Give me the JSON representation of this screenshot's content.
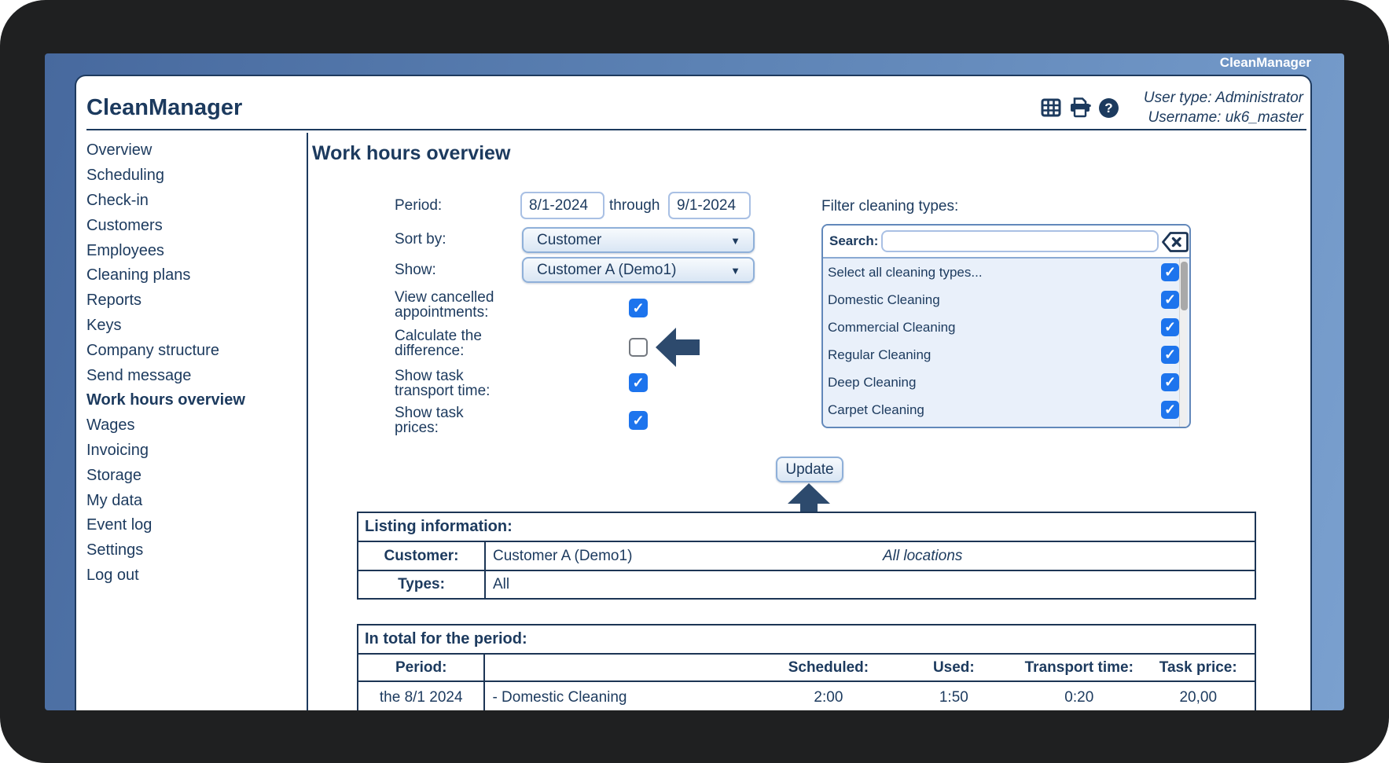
{
  "window": {
    "title": "CleanManager"
  },
  "header": {
    "app_title": "CleanManager",
    "user_type": "User type: Administrator",
    "username": "Username: uk6_master",
    "icons": [
      "table-grid",
      "printer",
      "help"
    ],
    "help_glyph": "?"
  },
  "sidebar": {
    "items": [
      {
        "label": "Overview",
        "active": false
      },
      {
        "label": "Scheduling",
        "active": false
      },
      {
        "label": "Check-in",
        "active": false
      },
      {
        "label": "Customers",
        "active": false
      },
      {
        "label": "Employees",
        "active": false
      },
      {
        "label": "Cleaning plans",
        "active": false
      },
      {
        "label": "Reports",
        "active": false
      },
      {
        "label": "Keys",
        "active": false
      },
      {
        "label": "Company structure",
        "active": false
      },
      {
        "label": "Send message",
        "active": false
      },
      {
        "label": "Work hours overview",
        "active": true
      },
      {
        "label": "Wages",
        "active": false
      },
      {
        "label": "Invoicing",
        "active": false
      },
      {
        "label": "Storage",
        "active": false
      },
      {
        "label": "My data",
        "active": false
      },
      {
        "label": "Event log",
        "active": false
      },
      {
        "label": "Settings",
        "active": false
      },
      {
        "label": "Log out",
        "active": false
      }
    ]
  },
  "main": {
    "heading": "Work hours overview",
    "form": {
      "period_label": "Period:",
      "period_from": "8/1-2024",
      "through_label": "through",
      "period_to": "9/1-2024",
      "sort_label": "Sort by:",
      "sort_value": "Customer",
      "show_label": "Show:",
      "show_value": "Customer A (Demo1)",
      "chevron": "▼",
      "checkboxes": [
        {
          "label": "View cancelled\nappointments:",
          "checked": true
        },
        {
          "label": "Calculate the\ndifference:",
          "checked": false
        },
        {
          "label": "Show task\ntransport time:",
          "checked": true
        },
        {
          "label": "Show task\nprices:",
          "checked": true
        }
      ]
    },
    "filter": {
      "title": "Filter cleaning types:",
      "search_label": "Search:",
      "search_value": "",
      "items": [
        {
          "label": "Select all cleaning types...",
          "checked": true
        },
        {
          "label": "Domestic Cleaning",
          "checked": true
        },
        {
          "label": "Commercial Cleaning",
          "checked": true
        },
        {
          "label": "Regular Cleaning",
          "checked": true
        },
        {
          "label": "Deep Cleaning",
          "checked": true
        },
        {
          "label": "Carpet Cleaning",
          "checked": true
        }
      ]
    },
    "update_button": "Update",
    "listing": {
      "title": "Listing information:",
      "customer_label": "Customer:",
      "customer_value": "Customer A (Demo1)",
      "customer_note": "All locations",
      "types_label": "Types:",
      "types_value": "All"
    },
    "totals": {
      "title": "In total for the period:",
      "columns": [
        "Period:",
        "",
        "Scheduled:",
        "Used:",
        "Transport time:",
        "Task price:"
      ],
      "rows": [
        {
          "period": "the 8/1 2024",
          "description": "- Domestic Cleaning",
          "scheduled": "2:00",
          "used": "1:50",
          "transport": "0:20",
          "price": "20,00"
        }
      ]
    }
  },
  "colors": {
    "navy": "#1c3a5e",
    "checkbox_blue": "#1d74ed",
    "window_blue": "#5c82b4",
    "frame_black": "#1f2021",
    "arrow_navy": "#2d4a6d"
  }
}
